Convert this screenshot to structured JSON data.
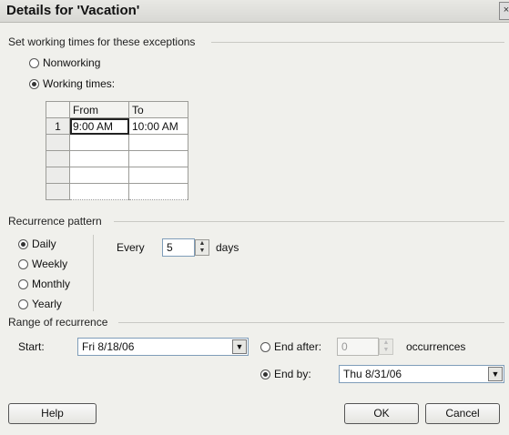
{
  "dialog": {
    "title": "Details for 'Vacation'",
    "close_glyph": "×"
  },
  "exceptions": {
    "section_label": "Set working times for these exceptions",
    "nonworking_label": "Nonworking",
    "working_times_label": "Working times:",
    "selected": "working_times",
    "table": {
      "headers": [
        "From",
        "To"
      ],
      "rows": [
        {
          "num": "1",
          "from": "9:00 AM",
          "to": "10:00 AM"
        },
        {
          "num": "",
          "from": "",
          "to": ""
        },
        {
          "num": "",
          "from": "",
          "to": ""
        },
        {
          "num": "",
          "from": "",
          "to": ""
        },
        {
          "num": "",
          "from": "",
          "to": ""
        }
      ]
    }
  },
  "recurrence": {
    "section_label": "Recurrence pattern",
    "options": [
      "Daily",
      "Weekly",
      "Monthly",
      "Yearly"
    ],
    "selected": "Daily",
    "every_label": "Every",
    "every_value": "5",
    "days_label": "days"
  },
  "range": {
    "section_label": "Range of recurrence",
    "start_label": "Start:",
    "start_value": "Fri 8/18/06",
    "end_after_label": "End after:",
    "end_after_value": "0",
    "occurrences_label": "occurrences",
    "end_by_label": "End by:",
    "end_by_value": "Thu 8/31/06",
    "selected": "end_by"
  },
  "buttons": {
    "help": "Help",
    "ok": "OK",
    "cancel": "Cancel"
  },
  "icons": {
    "spin": "spin-arrows",
    "dropdown": "chevron-down"
  }
}
